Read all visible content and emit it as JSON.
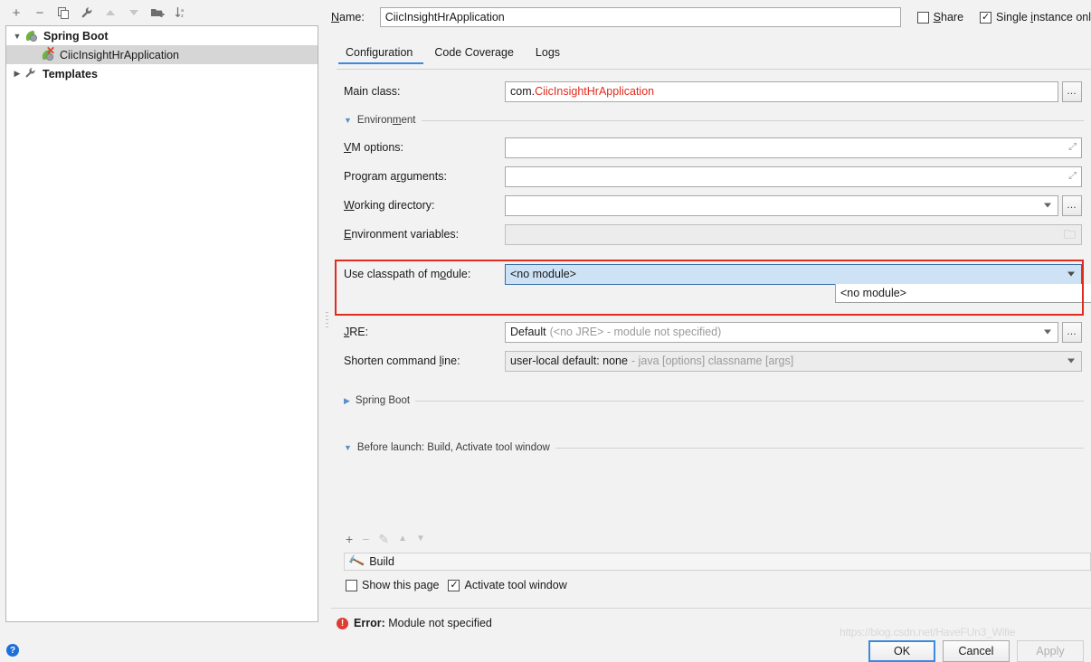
{
  "sidebar": {
    "toolbar": [
      {
        "name": "add",
        "glyph": "+",
        "disabled": false
      },
      {
        "name": "remove",
        "glyph": "−",
        "disabled": false
      },
      {
        "name": "copy",
        "glyph": "❐",
        "disabled": false
      },
      {
        "name": "edit-templates",
        "glyph": "ὒ7",
        "disabled": false
      },
      {
        "name": "move-up",
        "glyph": "▲",
        "disabled": true
      },
      {
        "name": "move-down",
        "glyph": "▼",
        "disabled": true
      },
      {
        "name": "new-folder",
        "glyph": "▰",
        "disabled": false
      },
      {
        "name": "sort",
        "glyph": "↓",
        "disabled": false
      }
    ],
    "tree": {
      "spring_boot": "Spring Boot",
      "application": "CiicInsightHrApplication",
      "templates": "Templates"
    },
    "help_glyph": "?"
  },
  "header": {
    "name_label": "Name:",
    "name_value": "CiicInsightHrApplication",
    "share_label": "Share",
    "share_checked": false,
    "single_instance_label": "Single instance onl",
    "single_instance_checked": true,
    "check_glyph": "✓"
  },
  "tabs": [
    {
      "label": "Configuration",
      "active": true
    },
    {
      "label": "Code Coverage",
      "active": false
    },
    {
      "label": "Logs",
      "active": false
    }
  ],
  "form": {
    "main_class": {
      "label": "Main class:",
      "value_prefix": "com.",
      "value_highlight": "CiicInsightHrApplication",
      "browse_glyph": "…"
    },
    "environment_section": "Environment",
    "vm_options": {
      "label": "VM options:",
      "value": ""
    },
    "program_arguments": {
      "label": "Program arguments:",
      "value": ""
    },
    "working_directory": {
      "label": "Working directory:",
      "value": "",
      "browse_glyph": "…"
    },
    "environment_variables": {
      "label": "Environment variables:",
      "value": ""
    },
    "use_classpath": {
      "label": "Use classpath of module:",
      "value": "<no module>",
      "options": [
        "<no module>"
      ]
    },
    "jre": {
      "label": "JRE:",
      "value_bold": "Default",
      "value_detail": "(<no JRE> - module not specified)",
      "browse_glyph": "…"
    },
    "shorten_command_line": {
      "label": "Shorten command line:",
      "value_bold": "user-local default: none",
      "value_detail": "- java [options] classname [args]"
    },
    "spring_boot_section": "Spring Boot"
  },
  "before_launch": {
    "section_title": "Before launch: Build, Activate tool window",
    "toolbar": [
      {
        "name": "add-task",
        "glyph": "+",
        "disabled": false
      },
      {
        "name": "remove-task",
        "glyph": "−",
        "disabled": true
      },
      {
        "name": "edit-task",
        "glyph": "✎",
        "disabled": true
      },
      {
        "name": "move-task-up",
        "glyph": "▲",
        "disabled": true
      },
      {
        "name": "move-task-down",
        "glyph": "▼",
        "disabled": true
      }
    ],
    "task": "Build",
    "show_this_page_label": "Show this page",
    "show_this_page_checked": false,
    "activate_tool_window_label": "Activate tool window",
    "activate_tool_window_checked": true
  },
  "footer": {
    "error_prefix": "Error:",
    "error_message": "Module not specified",
    "error_glyph": "!",
    "ok": "OK",
    "cancel": "Cancel",
    "apply": "Apply",
    "watermark": "https://blog.csdn.net/HaveFUn3_Wifie"
  },
  "colors": {
    "accent": "#3d89df",
    "error": "#dc3c32",
    "annotation": "#e02b1d",
    "spring_green": "#6db33f",
    "combo_highlight": "#cde2f5"
  }
}
